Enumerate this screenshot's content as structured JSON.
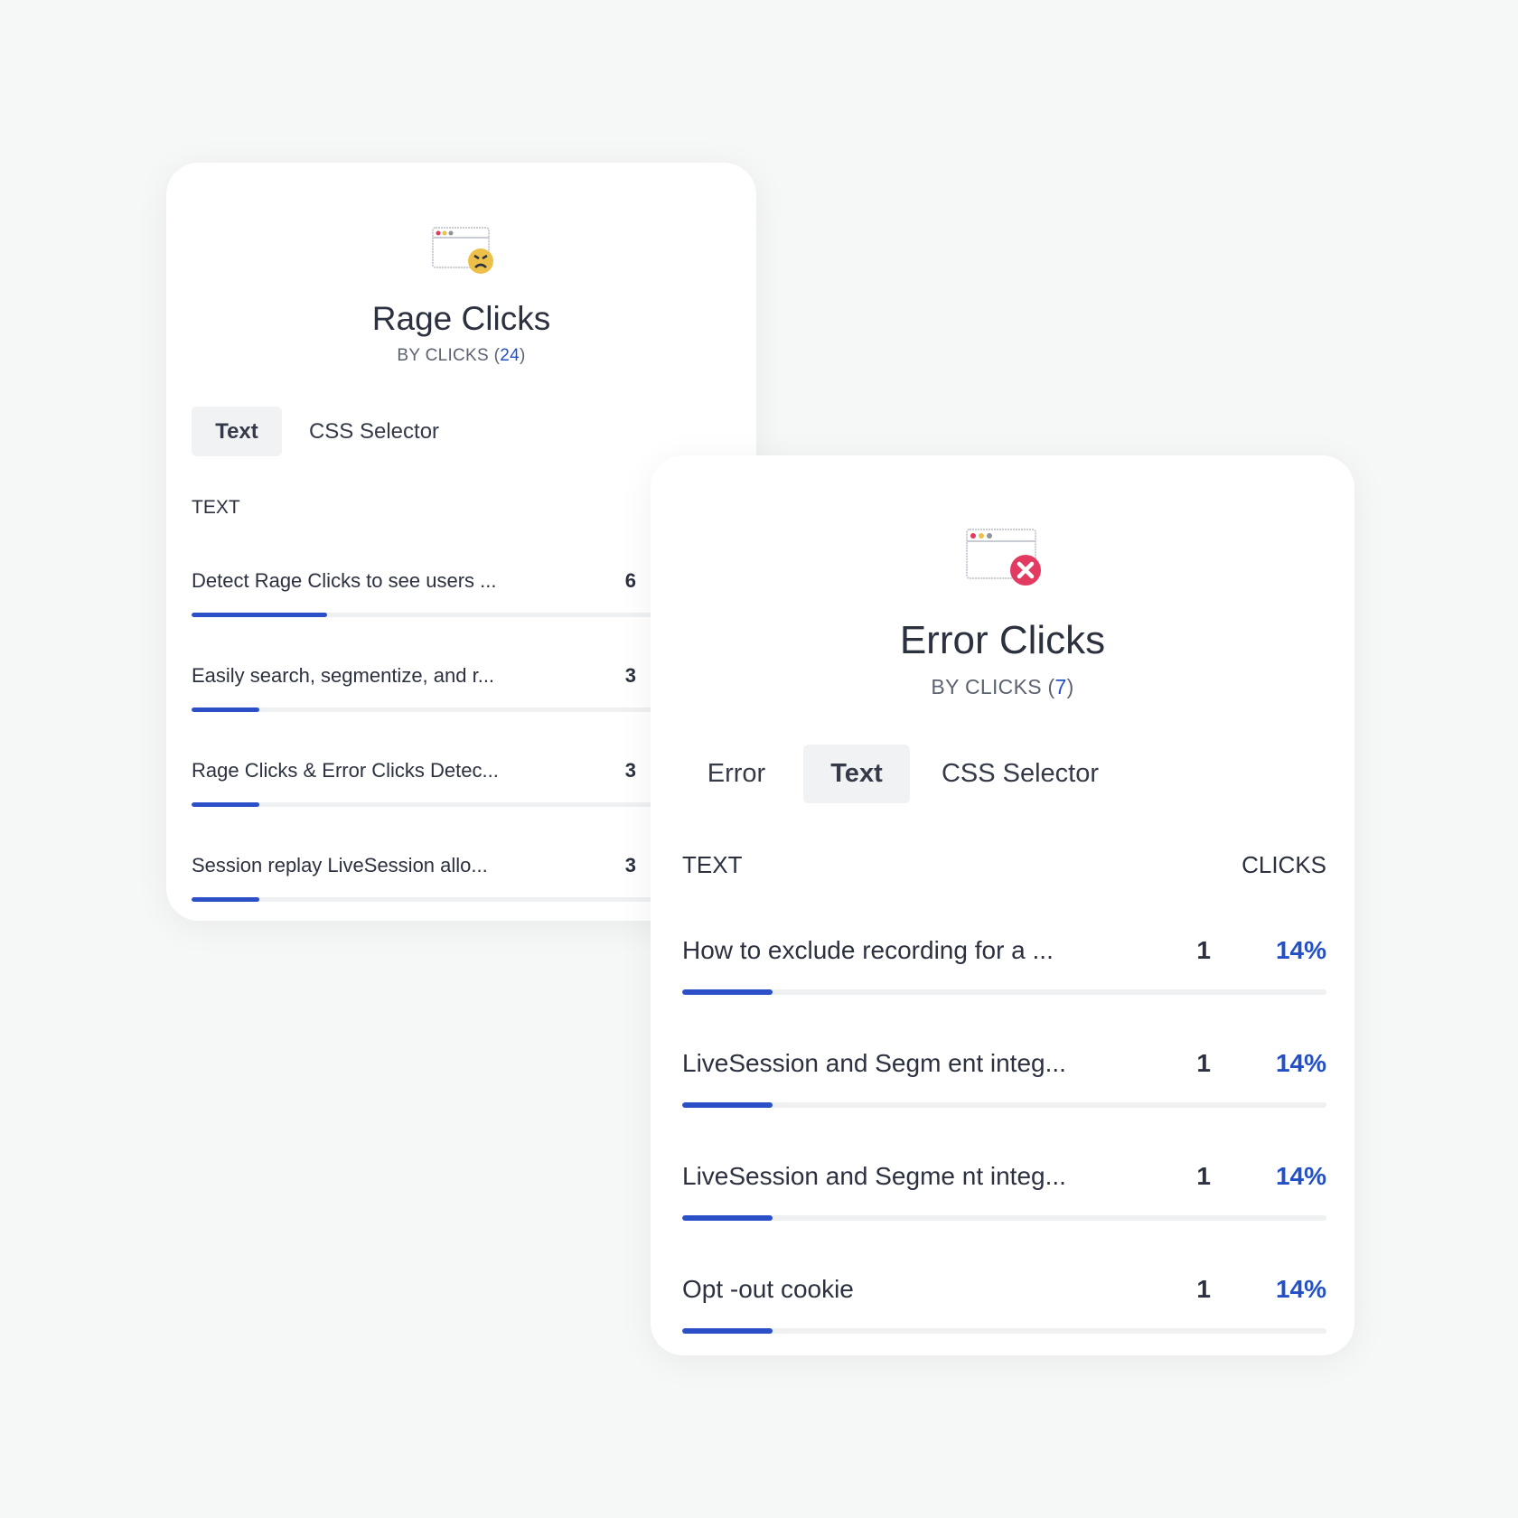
{
  "rage": {
    "title": "Rage Clicks",
    "subtitle_prefix": "BY CLICKS (",
    "total": "24",
    "subtitle_suffix": ")",
    "icon": "browser-window-angry-face-icon",
    "tabs": [
      {
        "label": "Text",
        "active": true
      },
      {
        "label": "CSS Selector",
        "active": false
      }
    ],
    "column_header": "TEXT",
    "rows": [
      {
        "text": "Detect Rage Clicks to see users ...",
        "count": "6",
        "share": 0.25
      },
      {
        "text": "Easily search, segmentize, and r...",
        "count": "3",
        "share": 0.125
      },
      {
        "text": "Rage Clicks & Error Clicks Detec...",
        "count": "3",
        "share": 0.125
      },
      {
        "text": "Session replay LiveSession allo...",
        "count": "3",
        "share": 0.125
      }
    ]
  },
  "error": {
    "title": "Error Clicks",
    "subtitle_prefix": "BY CLICKS (",
    "total": "7",
    "subtitle_suffix": ")",
    "icon": "browser-window-error-icon",
    "tabs": [
      {
        "label": "Error",
        "active": false
      },
      {
        "label": "Text",
        "active": true
      },
      {
        "label": "CSS Selector",
        "active": false
      }
    ],
    "column_header": "TEXT",
    "clicks_header": "CLICKS",
    "rows": [
      {
        "text": "How to exclude recording for a ...",
        "count": "1",
        "percent": "14%",
        "share": 0.14
      },
      {
        "text": "LiveSession and Segm ent integ...",
        "count": "1",
        "percent": "14%",
        "share": 0.14
      },
      {
        "text": "LiveSession and Segme nt integ...",
        "count": "1",
        "percent": "14%",
        "share": 0.14
      },
      {
        "text": "Opt -out cookie",
        "count": "1",
        "percent": "14%",
        "share": 0.14
      }
    ]
  },
  "colors": {
    "accent": "#2a4fc7",
    "track": "#eef0f2",
    "error_badge": "#e33a62",
    "angry_face": "#edc04a"
  }
}
